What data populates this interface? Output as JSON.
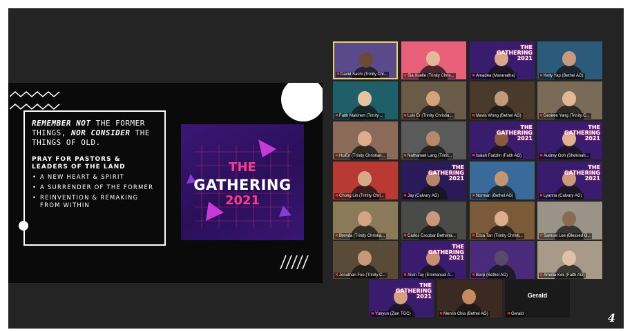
{
  "slide": {
    "verse_em1": "REMEMBER NOT",
    "verse_t1": " THE FORMER THINGS,",
    "verse_em2": " NOR CONSIDER",
    "verse_t2": " THE THINGS OF OLD.",
    "pray_title_line1": "PRAY FOR PASTORS &",
    "pray_title_line2": "LEADERS OF THE LAND",
    "bullets": [
      "A NEW HEART & SPIRIT",
      "A SURRENDER OF THE FORMER",
      "REINVENTION & REMAKING FROM WITHIN"
    ],
    "logo": {
      "the": "THE",
      "gathering": "GATHERING",
      "year": "2021"
    },
    "slashes": "/////"
  },
  "tile_sign": {
    "line1": "THE",
    "line2": "GATHERING",
    "line3": "2021"
  },
  "participants": [
    {
      "name": "David Sashi (Trinity Chr...",
      "bg": "#5b4a8a",
      "skin": "#6b4a35",
      "active": true
    },
    {
      "name": "Sia Xuelle (Trinity Chris...",
      "bg": "#e8607a",
      "skin": "#e3b99a"
    },
    {
      "name": "Amadea (Maranatha)",
      "bg": "#3a1c6e",
      "skin": "#d9a88a",
      "sign": true
    },
    {
      "name": "Kelly Yap (Bethel AG)",
      "bg": "#2c5a7a",
      "skin": "#c89a7c"
    },
    {
      "name": "Faith Makinen (Trinity ...",
      "bg": "#1f5f6a",
      "skin": "#e5c4a4"
    },
    {
      "name": "Lois Er (Trinity Christia...",
      "bg": "#6a5a48",
      "skin": "#d5a47e"
    },
    {
      "name": "Mavis Wong (Bethel AG)",
      "bg": "#4a3a2c",
      "skin": "#c29a7a"
    },
    {
      "name": "Desiree Yang (Trinity C...",
      "bg": "#7a6a58",
      "skin": "#e0b898"
    },
    {
      "name": "HuiEn (Trinity Christian...",
      "bg": "#8a6a58",
      "skin": "#dcae90"
    },
    {
      "name": "Nathanael Lang (Trinit...",
      "bg": "#5a5a5a",
      "skin": "#b58a6a"
    },
    {
      "name": "Isaiah Fadzlin (Faith AG)",
      "bg": "#3a1c6e",
      "skin": "#8a5a40",
      "sign": true
    },
    {
      "name": "Audrey Goh (Shekinah...",
      "bg": "#3a1c6e",
      "skin": "#e0b090",
      "sign": true
    },
    {
      "name": "Chong Lin (Trinity Chri...",
      "bg": "#b83a32",
      "skin": "#d8a888"
    },
    {
      "name": "Jay (Calvary AG)",
      "bg": "#2a1a5a",
      "skin": "#b5876a",
      "sign": true
    },
    {
      "name": "Norman (Bethel AG)",
      "bg": "#3a6a9a",
      "skin": "#c49474"
    },
    {
      "name": "Lyanna (Calvary AG)",
      "bg": "#3a1c6e",
      "skin": "#cc9a7a",
      "sign": true
    },
    {
      "name": "Brenda (Trinity Christia...",
      "bg": "#8a7a5a",
      "skin": "#d2a484"
    },
    {
      "name": "Carlos Escobar Bethsha...",
      "bg": "#4a4a48",
      "skin": "#c8987a"
    },
    {
      "name": "Elisa Tan (Trinity Christi...",
      "bg": "#7a5a38",
      "skin": "#dcae8c"
    },
    {
      "name": "Samuel Lee (Blessed G...",
      "bg": "#9a9488",
      "skin": "#8a6a50"
    },
    {
      "name": "Jonathan Foo (Trinity C...",
      "bg": "#5a4a38",
      "skin": "#c49878"
    },
    {
      "name": "Alvin Tay (Emmanuel A...",
      "bg": "#3a1c6e",
      "skin": "#c49070",
      "sign": true
    },
    {
      "name": "Benji (Bethel AG)",
      "bg": "#4a2a7a",
      "skin": "#5a4a6a"
    },
    {
      "name": "Amelia Kok (Faith AG)",
      "bg": "#a89a88",
      "skin": "#e0c0a8"
    },
    {
      "name": "Yunyun (Zion TGC)",
      "bg": "#3a1c6e",
      "skin": "#d4a080",
      "sign": true
    },
    {
      "name": "Mervin Chia (Bethel AG)",
      "bg": "#3a2a22",
      "skin": "#c48a60"
    },
    {
      "name": "Gerald",
      "bg": "#1a1a1a",
      "plain": "Gerald"
    }
  ],
  "page_number": "4"
}
